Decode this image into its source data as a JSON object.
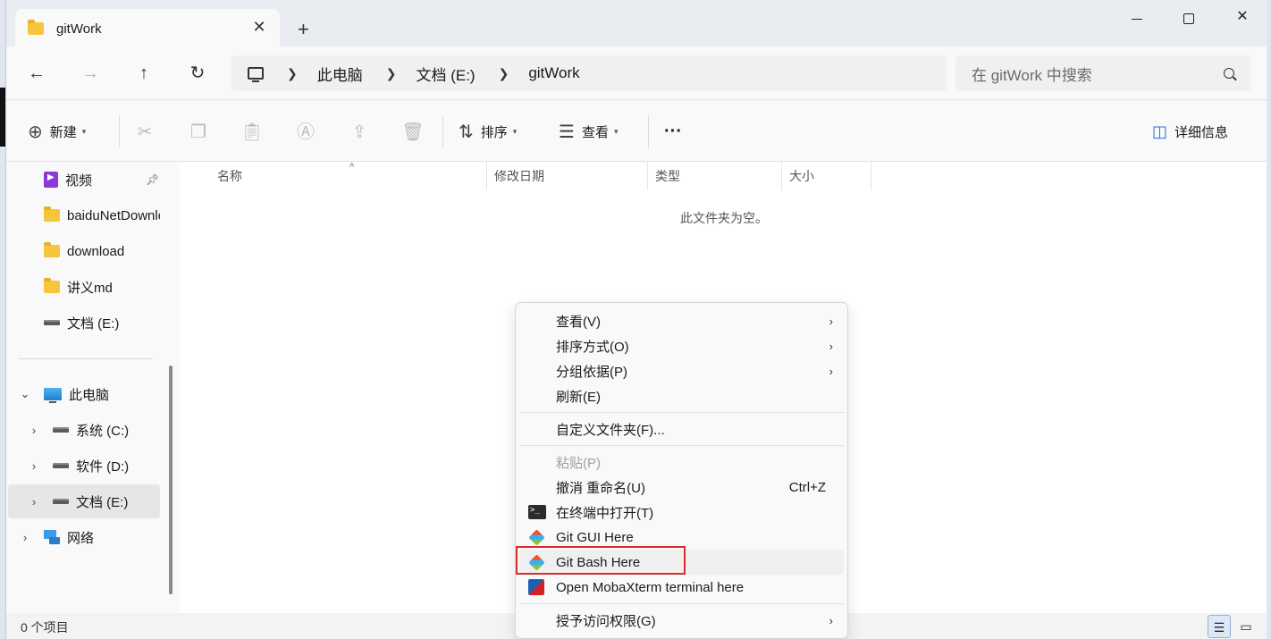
{
  "window": {
    "tab_title": "gitWork",
    "new_tab": "+",
    "min": "—",
    "max": "□",
    "close": "✕"
  },
  "nav": {
    "back": "←",
    "forward": "→",
    "up": "↑",
    "refresh": "↻",
    "breadcrumb": [
      "此电脑",
      "文档 (E:)",
      "gitWork"
    ],
    "search_placeholder": "在 gitWork 中搜索"
  },
  "toolbar": {
    "new_label": "新建",
    "sort_label": "排序",
    "view_label": "查看",
    "more_label": "···",
    "details_label": "详细信息"
  },
  "sidebar": {
    "items": [
      {
        "label": "视频",
        "icon": "video-icon",
        "pinned": true
      },
      {
        "label": "baiduNetDownload",
        "icon": "folder-icon"
      },
      {
        "label": "download",
        "icon": "folder-icon"
      },
      {
        "label": "讲义md",
        "icon": "folder-icon"
      },
      {
        "label": "文档 (E:)",
        "icon": "drive-icon"
      }
    ],
    "pc": {
      "label": "此电脑"
    },
    "drives": [
      {
        "label": "系统 (C:)"
      },
      {
        "label": "软件 (D:)"
      },
      {
        "label": "文档 (E:)",
        "selected": true
      }
    ],
    "network": {
      "label": "网络"
    }
  },
  "content": {
    "columns": [
      "名称",
      "修改日期",
      "类型",
      "大小"
    ],
    "empty_message": "此文件夹为空。"
  },
  "status": {
    "item_count": "0 个项目"
  },
  "context_menu": {
    "items": [
      {
        "label": "查看(V)",
        "submenu": true
      },
      {
        "label": "排序方式(O)",
        "submenu": true
      },
      {
        "label": "分组依据(P)",
        "submenu": true
      },
      {
        "label": "刷新(E)"
      },
      {
        "label": "自定义文件夹(F)..."
      },
      {
        "label": "粘贴(P)",
        "disabled": true
      },
      {
        "label": "撤消 重命名(U)",
        "shortcut": "Ctrl+Z"
      },
      {
        "label": "在终端中打开(T)",
        "icon": "terminal-icon"
      },
      {
        "label": "Git GUI Here",
        "icon": "git-icon"
      },
      {
        "label": "Git Bash Here",
        "icon": "git-icon",
        "highlighted": true
      },
      {
        "label": "Open MobaXterm terminal here",
        "icon": "mobaxterm-icon"
      },
      {
        "label": "授予访问权限(G)",
        "submenu": true
      }
    ],
    "highlight_color": "#d92c2c"
  }
}
